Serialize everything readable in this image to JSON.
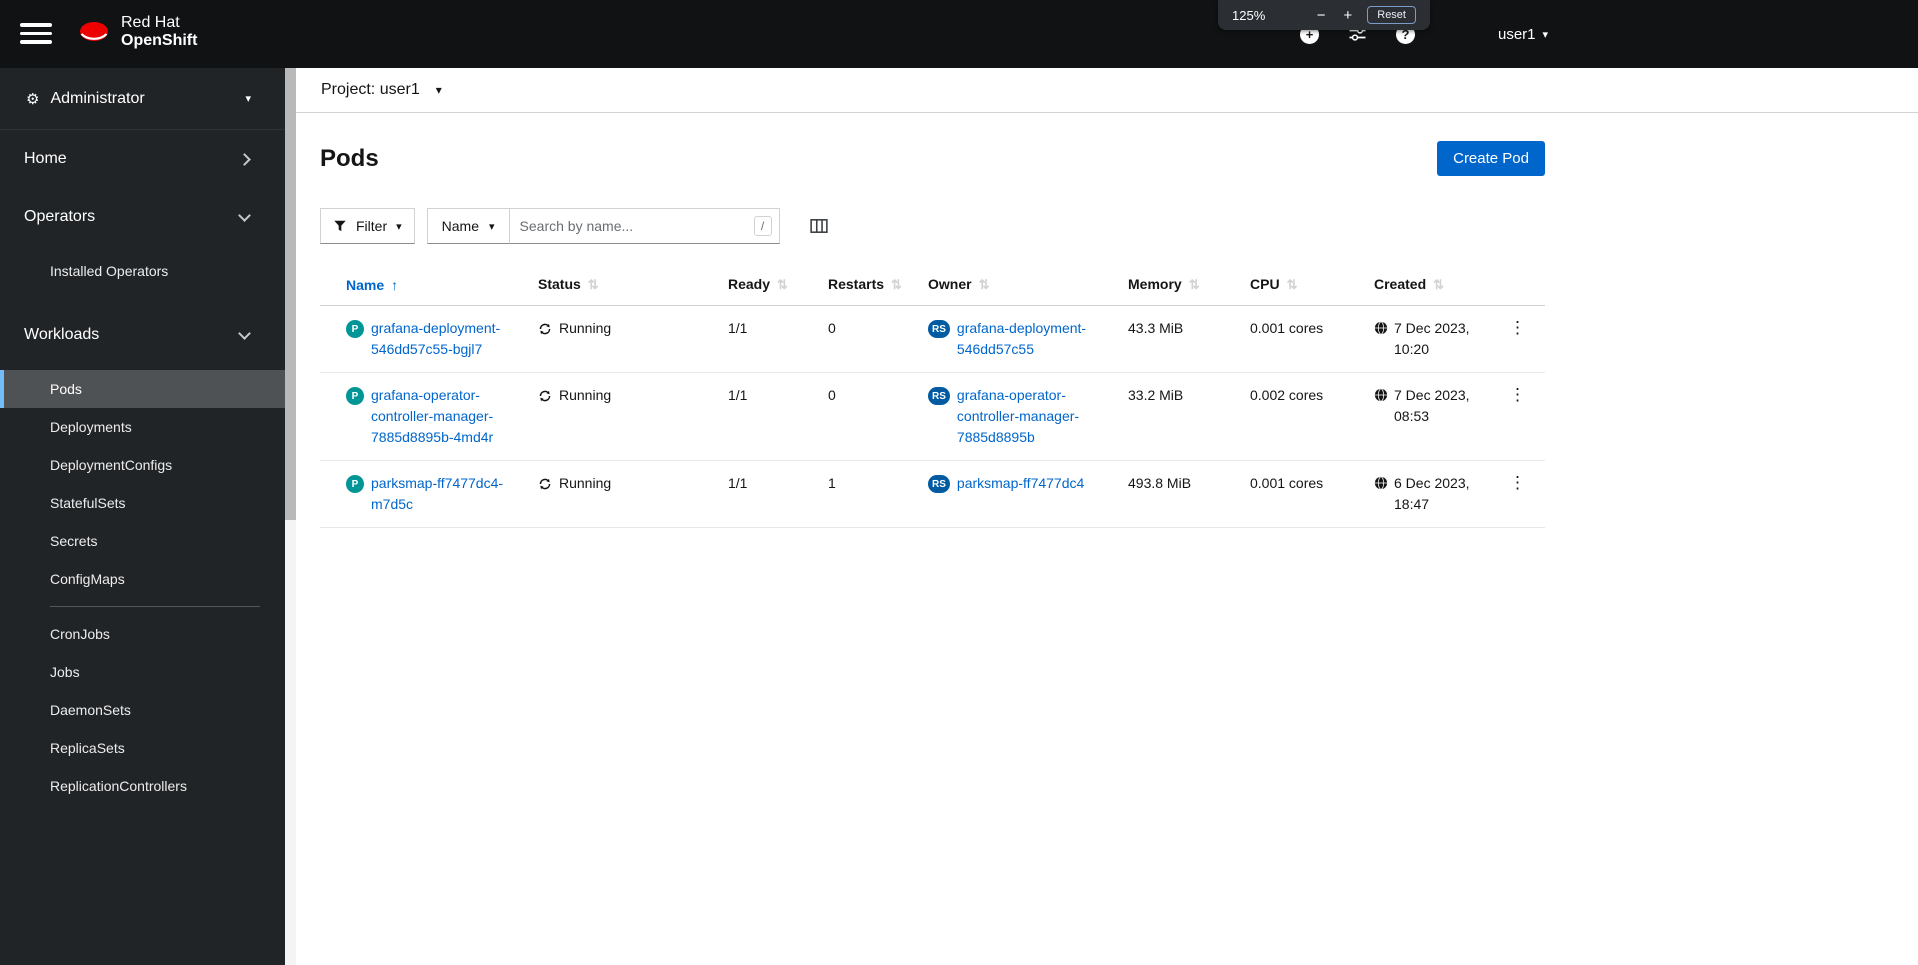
{
  "masthead": {
    "brand_line1": "Red Hat",
    "brand_line2": "OpenShift",
    "username": "user1"
  },
  "zoom_popup": {
    "level": "125%",
    "minus": "−",
    "plus": "+",
    "reset_label": "Reset"
  },
  "sidebar": {
    "perspective": "Administrator",
    "sections": [
      {
        "label": "Home"
      },
      {
        "label": "Operators",
        "items": [
          "Installed Operators"
        ]
      },
      {
        "label": "Workloads",
        "items": [
          "Pods",
          "Deployments",
          "DeploymentConfigs",
          "StatefulSets",
          "Secrets",
          "ConfigMaps",
          "CronJobs",
          "Jobs",
          "DaemonSets",
          "ReplicaSets",
          "ReplicationControllers"
        ]
      }
    ],
    "active_item": "Pods"
  },
  "project_bar": {
    "label": "Project: user1"
  },
  "page": {
    "title": "Pods",
    "create_button": "Create Pod"
  },
  "toolbar": {
    "filter_label": "Filter",
    "attribute_label": "Name",
    "search_placeholder": "Search by name...",
    "search_shortcut": "/"
  },
  "table": {
    "headers": [
      "Name",
      "Status",
      "Ready",
      "Restarts",
      "Owner",
      "Memory",
      "CPU",
      "Created"
    ],
    "sorted_by": "Name",
    "rows": [
      {
        "badge": "P",
        "name": "grafana-deployment-546dd57c55-bgjl7",
        "status": "Running",
        "ready": "1/1",
        "restarts": "0",
        "owner_badge": "RS",
        "owner": "grafana-deployment-546dd57c55",
        "memory": "43.3 MiB",
        "cpu": "0.001 cores",
        "created": "7 Dec 2023, 10:20"
      },
      {
        "badge": "P",
        "name": "grafana-operator-controller-manager-7885d8895b-4md4r",
        "status": "Running",
        "ready": "1/1",
        "restarts": "0",
        "owner_badge": "RS",
        "owner": "grafana-operator-controller-manager-7885d8895b",
        "memory": "33.2 MiB",
        "cpu": "0.002 cores",
        "created": "7 Dec 2023, 08:53"
      },
      {
        "badge": "P",
        "name": "parksmap-ff7477dc4-m7d5c",
        "status": "Running",
        "ready": "1/1",
        "restarts": "1",
        "owner_badge": "RS",
        "owner": "parksmap-ff7477dc4",
        "memory": "493.8 MiB",
        "cpu": "0.001 cores",
        "created": "6 Dec 2023, 18:47"
      }
    ]
  },
  "glyphs": {
    "caret_down": "▾",
    "sort_asc": "↑",
    "sort_both": "⇅",
    "kebab": "⋮",
    "gear": "⚙",
    "plus": "+",
    "question": "?"
  },
  "colors": {
    "accent": "#0066cc",
    "pod_badge": "#009596",
    "replicaset_badge": "#005ba3",
    "masthead": "#101214",
    "sidebar": "#212427"
  }
}
